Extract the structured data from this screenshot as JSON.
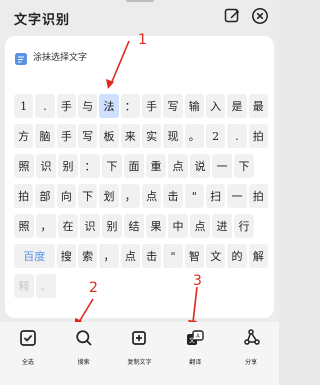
{
  "header": {
    "title": "文字识别"
  },
  "document": {
    "name": "涂抹选择文字"
  },
  "text_lines": [
    [
      "1",
      ".",
      "手",
      "与",
      "法",
      "：",
      "手",
      "写",
      "输",
      "入",
      "是",
      "最"
    ],
    [
      "方",
      "脑",
      "手",
      "写",
      "板",
      "来",
      "实",
      "现",
      "。",
      "2",
      ".",
      "拍"
    ],
    [
      "照",
      "识",
      "别",
      "：",
      "下",
      "面",
      "重",
      "点",
      "说",
      "一",
      "下"
    ],
    [
      "拍",
      "部",
      "向",
      "下",
      "划",
      "，",
      "点",
      "击",
      "\"",
      "扫",
      "一",
      "拍"
    ],
    [
      "照",
      "，",
      "在",
      "识",
      "别",
      "结",
      "果",
      "中",
      "点",
      "进",
      "行"
    ],
    [
      "百度",
      "搜",
      "索",
      "，",
      "点",
      "击",
      "\"",
      "智",
      "文",
      "的",
      "解"
    ],
    [
      "释",
      "。"
    ]
  ],
  "selected_token": "法",
  "bottom_actions": [
    {
      "label": "全选",
      "icon": "select-all-icon"
    },
    {
      "label": "搜索",
      "icon": "search-icon"
    },
    {
      "label": "复制文字",
      "icon": "copy-icon"
    },
    {
      "label": "翻译",
      "icon": "translate-icon"
    },
    {
      "label": "分享",
      "icon": "share-icon"
    }
  ],
  "annotations": {
    "one": "1",
    "two": "2",
    "three": "3"
  },
  "colors": {
    "accent_blue": "#5a90e6",
    "selection": "#cfe0ff",
    "annotation_red": "#e0281c"
  }
}
